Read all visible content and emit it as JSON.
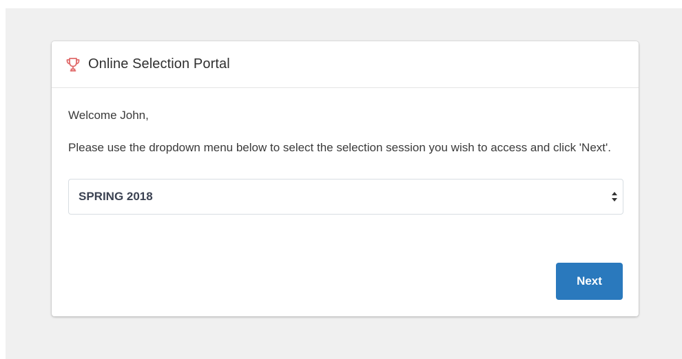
{
  "header": {
    "icon": "trophy-icon",
    "title": "Online Selection Portal"
  },
  "body": {
    "welcome": "Welcome John,",
    "instructions": "Please use the dropdown menu below to select the selection session you wish to access and click 'Next'."
  },
  "session_select": {
    "selected": "SPRING 2018",
    "arrow_icon": "select-arrows-icon"
  },
  "actions": {
    "next_label": "Next"
  },
  "colors": {
    "accent": "#2a79bd",
    "icon": "#e06a6a"
  }
}
